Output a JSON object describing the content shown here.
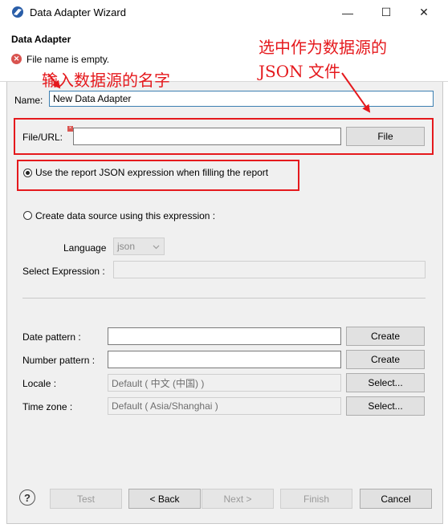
{
  "window": {
    "title": "Data Adapter Wizard",
    "minimize_glyph": "—",
    "maximize_glyph": "☐",
    "close_glyph": "✕"
  },
  "header": {
    "title": "Data Adapter",
    "error_icon": "error-icon",
    "error_glyph": "✕",
    "message": "File name is empty."
  },
  "annotations": {
    "name_hint": "输入数据源的名字",
    "json_hint_line1": "选中作为数据源的",
    "json_hint_line2": "JSON 文件"
  },
  "form": {
    "name_label": "Name:",
    "name_value": "New Data Adapter",
    "file_label": "File/URL:",
    "file_value": "",
    "file_button": "File",
    "radio_report_json": "Use the report JSON expression when filling the report",
    "radio_report_json_checked": true,
    "radio_create_ds": "Create data source using this expression :",
    "radio_create_ds_checked": false,
    "language_label": "Language",
    "language_value": "json",
    "select_expression_label": "Select Expression :",
    "select_expression_value": "",
    "date_pattern_label": "Date pattern :",
    "date_pattern_value": "",
    "date_create_button": "Create",
    "number_pattern_label": "Number pattern :",
    "number_pattern_value": "",
    "number_create_button": "Create",
    "locale_label": "Locale :",
    "locale_value": "Default ( 中文 (中国) )",
    "locale_select_button": "Select...",
    "timezone_label": "Time zone :",
    "timezone_value": "Default ( Asia/Shanghai )",
    "timezone_select_button": "Select..."
  },
  "footer": {
    "help_glyph": "?",
    "test": "Test",
    "back": "< Back",
    "next": "Next >",
    "finish": "Finish",
    "cancel": "Cancel"
  },
  "colors": {
    "annotation_red": "#e5191d",
    "dialog_bg": "#f0f0f0"
  }
}
